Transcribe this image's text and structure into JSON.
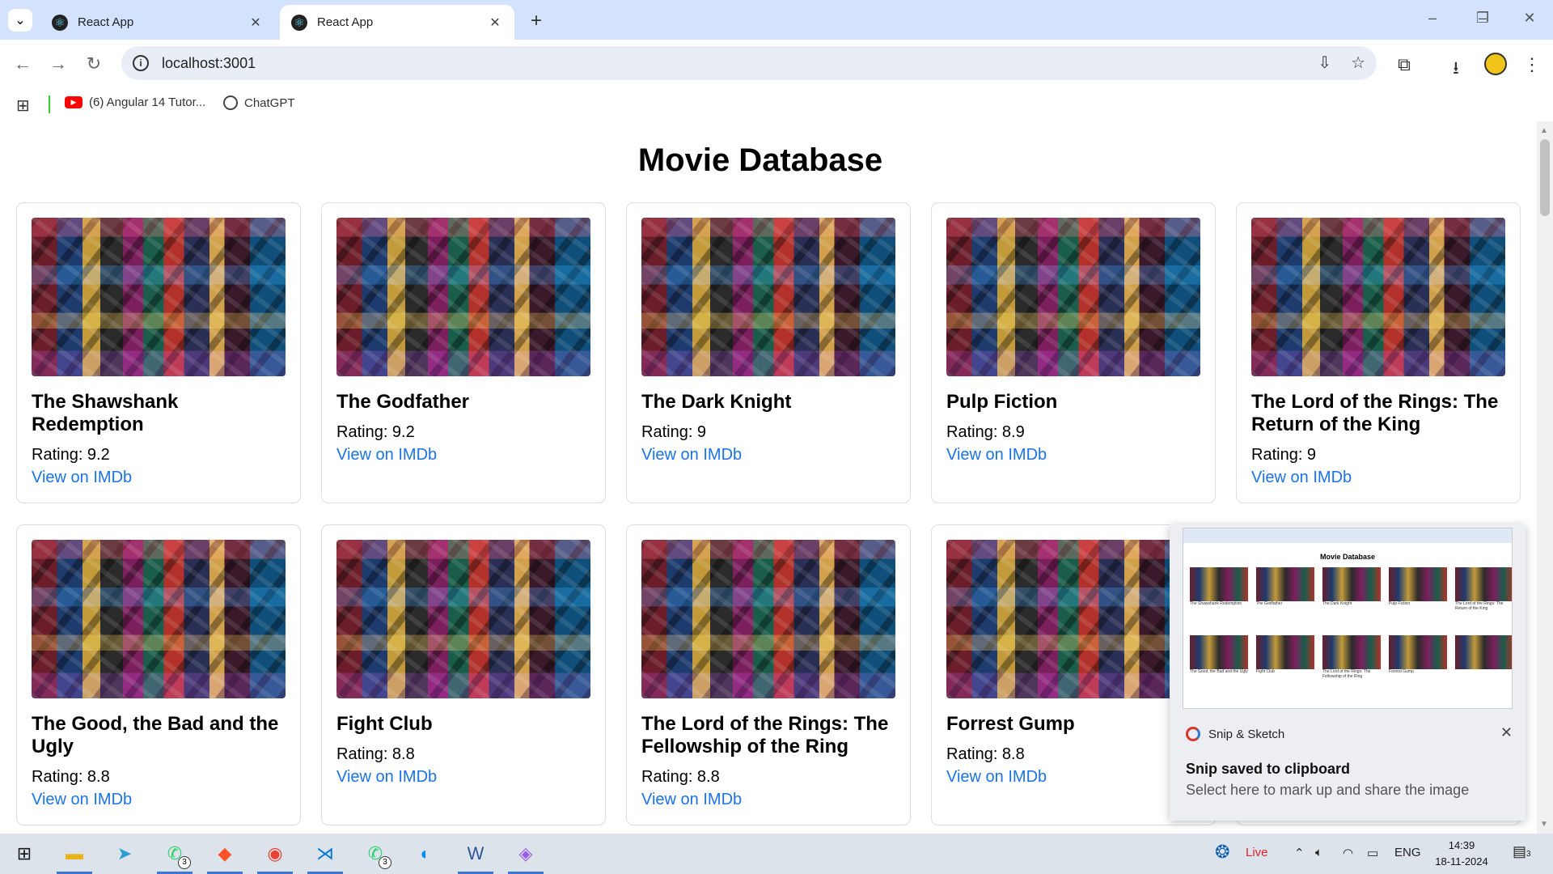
{
  "browser": {
    "tabs": [
      {
        "title": "React App",
        "active": false
      },
      {
        "title": "React App",
        "active": true
      }
    ],
    "url": "localhost:3001",
    "bookmarks": [
      {
        "label": "(6) Angular 14 Tutor...",
        "icon": "youtube-icon"
      },
      {
        "label": "ChatGPT",
        "icon": "chatgpt-icon"
      }
    ],
    "accent_color": "#d3e3fd"
  },
  "page": {
    "title": "Movie Database",
    "rating_prefix": "Rating: ",
    "link_label": "View on IMDb",
    "movies": [
      {
        "title": "The Shawshank Redemption",
        "rating": "Rating: 9.2",
        "link": "View on IMDb"
      },
      {
        "title": "The Godfather",
        "rating": "Rating: 9.2",
        "link": "View on IMDb"
      },
      {
        "title": "The Dark Knight",
        "rating": "Rating: 9",
        "link": "View on IMDb"
      },
      {
        "title": "Pulp Fiction",
        "rating": "Rating: 8.9",
        "link": "View on IMDb"
      },
      {
        "title": "The Lord of the Rings: The Return of the King",
        "rating": "Rating: 9",
        "link": "View on IMDb"
      },
      {
        "title": "The Good, the Bad and the Ugly",
        "rating": "Rating: 8.8",
        "link": "View on IMDb"
      },
      {
        "title": "Fight Club",
        "rating": "Rating: 8.8",
        "link": "View on IMDb"
      },
      {
        "title": "The Lord of the Rings: The Fellowship of the Ring",
        "rating": "Rating: 8.8",
        "link": "View on IMDb"
      },
      {
        "title": "Forrest Gump",
        "rating": "Rating: 8.8",
        "link": "View on IMDb"
      },
      {
        "title": "",
        "rating": "",
        "link": ""
      }
    ],
    "link_color": "#1a73e8"
  },
  "notification": {
    "app": "Snip & Sketch",
    "title": "Snip saved to clipboard",
    "body": "Select here to mark up and share the image",
    "preview_title": "Movie Database"
  },
  "taskbar": {
    "live_label": "Live",
    "language": "ENG",
    "time": "14:39",
    "date": "18-11-2024",
    "notification_count": "3",
    "whatsapp_badge": "3"
  }
}
